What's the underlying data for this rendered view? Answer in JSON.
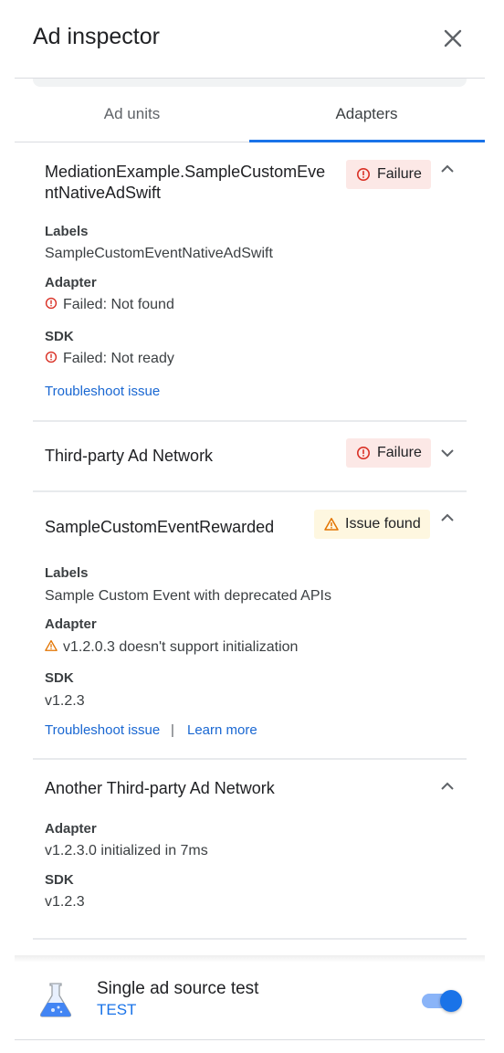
{
  "header": {
    "title": "Ad inspector",
    "close_icon": "close-icon"
  },
  "tabs": [
    {
      "label": "Ad units",
      "selected": false
    },
    {
      "label": "Adapters",
      "selected": true
    }
  ],
  "colors": {
    "accent": "#1a73e8",
    "failure": "#d93025",
    "warning": "#e37400",
    "link": "#1967d2"
  },
  "adapters": [
    {
      "title_line1": "MediationExample.SampleCustomEve",
      "title_line2": "ntNativeAdSwift",
      "status": "Failure",
      "status_icon": "error-icon",
      "expanded": true,
      "labels_heading": "Labels",
      "labels_value": "SampleCustomEventNativeAdSwift",
      "adapter_heading": "Adapter",
      "adapter_value": "Failed: Not found",
      "sdk_heading": "SDK",
      "sdk_value": "Failed: Not ready",
      "link1": "Troubleshoot issue"
    },
    {
      "title": "Third-party Ad Network",
      "status": "Failure",
      "status_icon": "error-icon",
      "expanded": false
    },
    {
      "title": "SampleCustomEventRewarded",
      "status": "Issue found",
      "status_icon": "warning-icon",
      "expanded": true,
      "labels_heading": "Labels",
      "labels_value": "Sample Custom Event with deprecated APIs",
      "adapter_heading": "Adapter",
      "adapter_value": "v1.2.0.3 doesn't support initialization",
      "sdk_heading": "SDK",
      "sdk_value": "v1.2.3",
      "link1": "Troubleshoot issue",
      "separator": "|",
      "link2": "Learn more"
    },
    {
      "title": "Another Third-party Ad Network",
      "expanded": true,
      "adapter_heading": "Adapter",
      "adapter_value": "v1.2.3.0 initialized in 7ms",
      "sdk_heading": "SDK",
      "sdk_value": "v1.2.3"
    }
  ],
  "footer": {
    "title": "Single ad source test",
    "subtitle": "TEST",
    "icon": "flask-icon",
    "toggle_on": true
  }
}
